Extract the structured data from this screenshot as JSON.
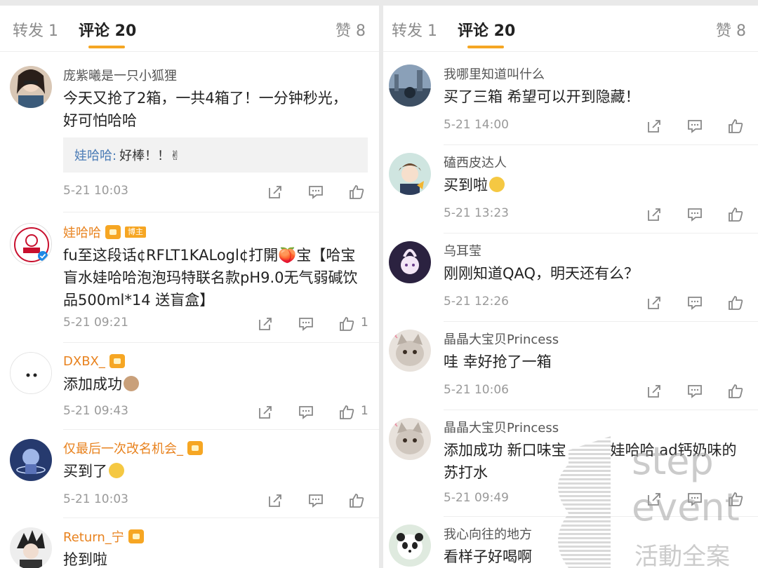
{
  "left": {
    "tabs": {
      "repost": "转发 1",
      "comment": "评论 20",
      "like": "赞 8"
    },
    "comments": [
      {
        "name": "庞紫曦是一只小狐狸",
        "text": "今天又抢了2箱，一共4箱了！一分钟秒光，好可怕哈哈",
        "reply_name": "娃哈哈:",
        "reply_text": "好棒！！✌",
        "time": "5-21 10:03",
        "likes": ""
      },
      {
        "name": "娃哈哈",
        "badge": "博主",
        "text": "fu至这段话¢RFLT1KALogl¢打開🍑宝【哈宝盲水娃哈哈泡泡玛特联名款pH9.0无气弱碱饮品500ml*14 送盲盒】",
        "time": "5-21 09:21",
        "likes": "1"
      },
      {
        "name": "DXBX_",
        "text": "添加成功",
        "time": "5-21 09:43",
        "likes": "1"
      },
      {
        "name": "仅最后一次改名机会_",
        "text": "买到了",
        "time": "5-21 10:03",
        "likes": ""
      },
      {
        "name": "Return_宁",
        "text": "抢到啦",
        "time": "",
        "likes": ""
      }
    ]
  },
  "right": {
    "tabs": {
      "repost": "转发 1",
      "comment": "评论 20",
      "like": "赞 8"
    },
    "comments": [
      {
        "name": "我哪里知道叫什么",
        "text": "买了三箱 希望可以开到隐藏！",
        "time": "5-21 14:00"
      },
      {
        "name": "磕西皮达人",
        "text": "买到啦",
        "time": "5-21 13:23"
      },
      {
        "name": "乌耳莹",
        "text": "刚刚知道QAQ，明天还有么？",
        "time": "5-21 12:26"
      },
      {
        "name": "晶晶大宝贝Princess",
        "text": "哇 幸好抢了一箱",
        "time": "5-21 10:06"
      },
      {
        "name": "晶晶大宝贝Princess",
        "text": "添加成功 新口味宝　　　娃哈哈 ad钙奶味的苏打水",
        "time": "5-21 09:49"
      },
      {
        "name": "我心向往的地方",
        "text": "看样子好喝啊",
        "time": ""
      }
    ]
  },
  "watermark": {
    "line1": "step",
    "line2": "event",
    "line3": "活動全案"
  },
  "colors": {
    "accent_underline": "#f5a623",
    "username_orange": "#e8821e",
    "reply_name_blue": "#4a7bb5"
  }
}
